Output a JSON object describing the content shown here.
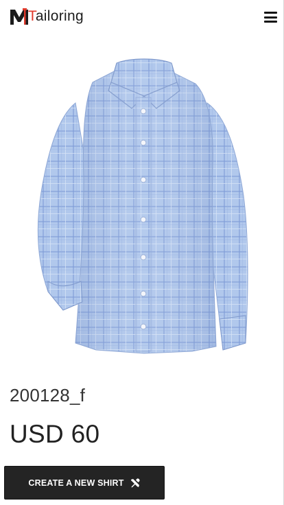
{
  "brand": {
    "logo_mark": "M",
    "logo_accent": "T",
    "logo_rest": "ailoring",
    "accent_color": "#e0392b"
  },
  "header": {
    "menu_icon": "hamburger-menu-icon"
  },
  "product": {
    "image_alt": "Light blue checked shirt",
    "shirt_color": "#a9c3e8",
    "code": "200128_f",
    "price": "USD 60"
  },
  "actions": {
    "create_label": "CREATE A NEW SHIRT",
    "create_icon": "tools-icon"
  }
}
